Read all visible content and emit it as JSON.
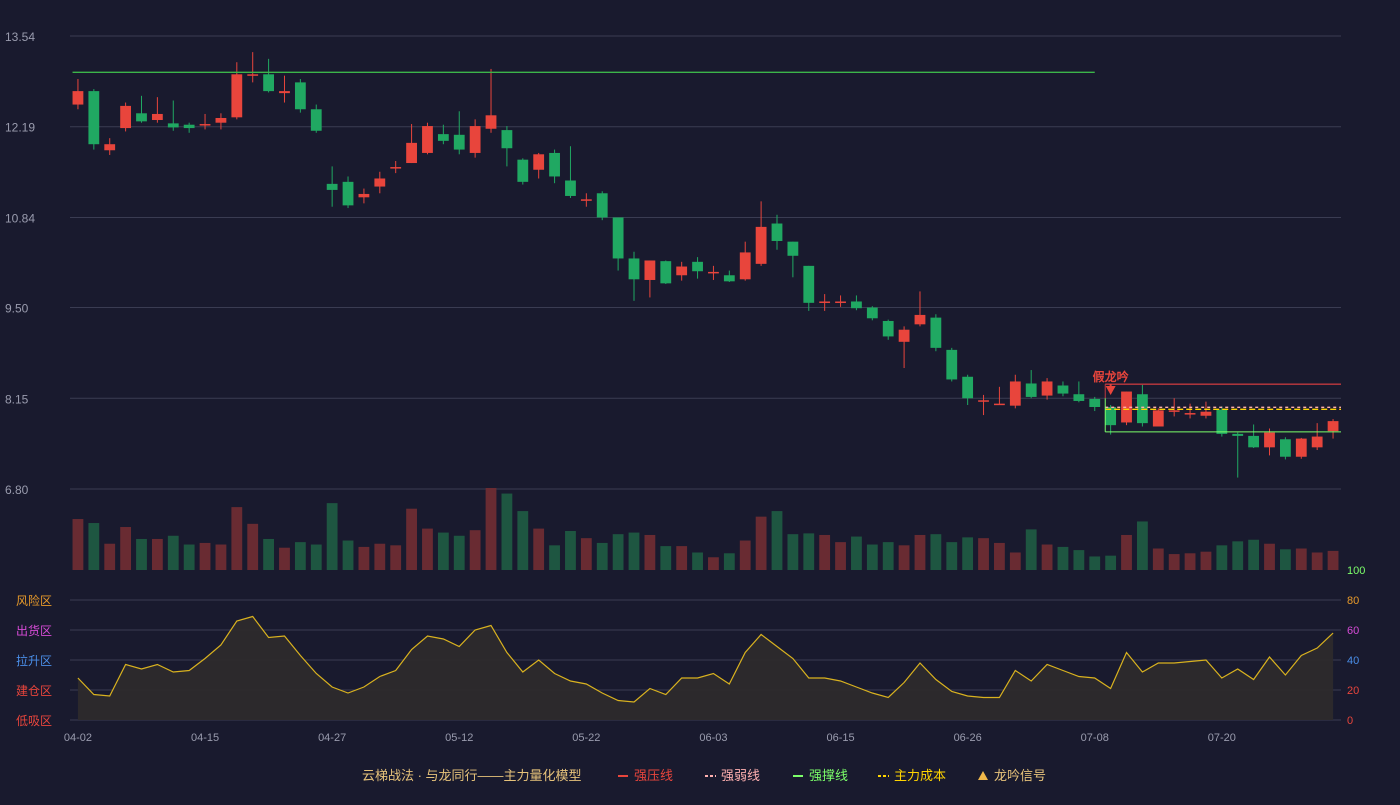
{
  "colors": {
    "background": "#191a2e",
    "up": "#e8453c",
    "down": "#20a862",
    "grid": "#3a3c52",
    "axis_text": "#9a9cae",
    "resistance": "#e8453c",
    "weak": "#ffb0b0",
    "support": "#7cff6a",
    "cost": "#ffd400",
    "signal": "#f0b84a",
    "osc_line": "#d9b21f",
    "zone_risk": "#e89a2a",
    "zone_sell": "#d64bd6",
    "zone_rise": "#4a8ee8",
    "zone_build": "#e8453c",
    "zone_low": "#e8453c"
  },
  "chart_data": [
    {
      "type": "candlestick",
      "ylim": [
        6.8,
        13.54
      ],
      "y_ticks": [
        "13.54",
        "12.19",
        "10.84",
        "9.50",
        "8.15",
        "6.80"
      ],
      "x_tick_labels": [
        {
          "index": 0,
          "label": "04-02"
        },
        {
          "index": 8,
          "label": "04-15"
        },
        {
          "index": 16,
          "label": "04-27"
        },
        {
          "index": 24,
          "label": "05-12"
        },
        {
          "index": 32,
          "label": "05-22"
        },
        {
          "index": 40,
          "label": "06-03"
        },
        {
          "index": 48,
          "label": "06-15"
        },
        {
          "index": 56,
          "label": "06-26"
        },
        {
          "index": 64,
          "label": "07-08"
        },
        {
          "index": 72,
          "label": "07-20"
        }
      ],
      "candles": [
        [
          12.52,
          12.72,
          12.9,
          12.45
        ],
        [
          12.72,
          11.93,
          12.75,
          11.85
        ],
        [
          11.84,
          11.93,
          12.02,
          11.77
        ],
        [
          12.17,
          12.5,
          12.55,
          12.12
        ],
        [
          12.39,
          12.27,
          12.65,
          12.25
        ],
        [
          12.29,
          12.38,
          12.63,
          12.25
        ],
        [
          12.24,
          12.18,
          12.58,
          12.13
        ],
        [
          12.22,
          12.17,
          12.25,
          12.1
        ],
        [
          12.23,
          12.23,
          12.38,
          12.15
        ],
        [
          12.25,
          12.32,
          12.39,
          12.15
        ],
        [
          12.33,
          12.97,
          13.15,
          12.3
        ],
        [
          12.95,
          12.97,
          13.3,
          12.85
        ],
        [
          12.97,
          12.72,
          13.2,
          12.7
        ],
        [
          12.69,
          12.72,
          12.95,
          12.55
        ],
        [
          12.85,
          12.45,
          12.9,
          12.4
        ],
        [
          12.45,
          12.13,
          12.52,
          12.1
        ],
        [
          11.34,
          11.25,
          11.6,
          11.0
        ],
        [
          11.37,
          11.02,
          11.45,
          10.98
        ],
        [
          11.14,
          11.19,
          11.27,
          11.05
        ],
        [
          11.3,
          11.42,
          11.52,
          11.2
        ],
        [
          11.59,
          11.59,
          11.68,
          11.5
        ],
        [
          11.65,
          11.95,
          12.23,
          11.65
        ],
        [
          11.8,
          12.2,
          12.25,
          11.78
        ],
        [
          12.08,
          11.98,
          12.22,
          11.93
        ],
        [
          12.07,
          11.85,
          12.42,
          11.78
        ],
        [
          11.8,
          12.2,
          12.3,
          11.73
        ],
        [
          12.16,
          12.36,
          13.05,
          12.1
        ],
        [
          12.14,
          11.87,
          12.2,
          11.6
        ],
        [
          11.7,
          11.37,
          11.72,
          11.33
        ],
        [
          11.55,
          11.78,
          11.8,
          11.42
        ],
        [
          11.8,
          11.45,
          11.85,
          11.35
        ],
        [
          11.39,
          11.16,
          11.9,
          11.13
        ],
        [
          11.11,
          11.11,
          11.2,
          11.0
        ],
        [
          11.2,
          10.84,
          11.23,
          10.8
        ],
        [
          10.84,
          10.23,
          10.84,
          10.05
        ],
        [
          10.23,
          9.92,
          10.33,
          9.6
        ],
        [
          9.91,
          10.2,
          10.2,
          9.65
        ],
        [
          10.19,
          9.86,
          10.2,
          9.85
        ],
        [
          9.98,
          10.11,
          10.18,
          9.9
        ],
        [
          10.18,
          10.04,
          10.25,
          9.93
        ],
        [
          10.03,
          10.03,
          10.12,
          9.91
        ],
        [
          9.98,
          9.89,
          10.05,
          9.88
        ],
        [
          9.92,
          10.32,
          10.48,
          9.9
        ],
        [
          10.15,
          10.7,
          11.08,
          10.12
        ],
        [
          10.75,
          10.49,
          10.88,
          10.36
        ],
        [
          10.48,
          10.27,
          10.48,
          9.95
        ],
        [
          10.12,
          9.57,
          10.12,
          9.45
        ],
        [
          9.59,
          9.59,
          9.7,
          9.45
        ],
        [
          9.59,
          9.59,
          9.68,
          9.51
        ],
        [
          9.59,
          9.49,
          9.68,
          9.46
        ],
        [
          9.5,
          9.34,
          9.52,
          9.31
        ],
        [
          9.3,
          9.07,
          9.32,
          9.02
        ],
        [
          8.99,
          9.17,
          9.22,
          8.6
        ],
        [
          9.25,
          9.39,
          9.74,
          9.22
        ],
        [
          9.35,
          8.9,
          9.4,
          8.85
        ],
        [
          8.87,
          8.43,
          8.9,
          8.4
        ],
        [
          8.47,
          8.15,
          8.5,
          8.05
        ],
        [
          8.12,
          8.12,
          8.2,
          7.9
        ],
        [
          8.07,
          8.07,
          8.32,
          8.05
        ],
        [
          8.04,
          8.4,
          8.5,
          8.0
        ],
        [
          8.37,
          8.17,
          8.57,
          8.15
        ],
        [
          8.19,
          8.4,
          8.45,
          8.13
        ],
        [
          8.34,
          8.22,
          8.4,
          8.18
        ],
        [
          8.21,
          8.11,
          8.4,
          8.09
        ],
        [
          8.14,
          8.02,
          8.17,
          7.96
        ],
        [
          8.02,
          7.75,
          8.05,
          7.61
        ],
        [
          7.79,
          8.25,
          8.25,
          7.75
        ],
        [
          8.21,
          7.78,
          8.35,
          7.73
        ],
        [
          7.73,
          7.97,
          8.0,
          7.73
        ],
        [
          7.97,
          7.97,
          8.15,
          7.88
        ],
        [
          7.93,
          7.93,
          8.07,
          7.85
        ],
        [
          7.89,
          7.95,
          8.1,
          7.85
        ],
        [
          7.98,
          7.62,
          8.03,
          7.58
        ],
        [
          7.62,
          7.59,
          7.64,
          6.97
        ],
        [
          7.59,
          7.42,
          7.76,
          7.41
        ],
        [
          7.42,
          7.64,
          7.7,
          7.3
        ],
        [
          7.54,
          7.28,
          7.57,
          7.24
        ],
        [
          7.28,
          7.55,
          7.56,
          7.25
        ],
        [
          7.42,
          7.58,
          7.78,
          7.38
        ],
        [
          7.66,
          7.81,
          7.84,
          7.55
        ]
      ],
      "lines": [
        {
          "name": "强压线",
          "style": "resistance",
          "value": 13.0,
          "from": 0,
          "to": 64
        },
        {
          "name": "强压线",
          "style": "resistance",
          "value": 8.36,
          "from": 65,
          "to": 79
        },
        {
          "name": "强弱线",
          "style": "weak",
          "value": 8.0,
          "from": 65,
          "to": 79
        },
        {
          "name": "主力成本",
          "style": "cost",
          "value": 8.0,
          "from": 65,
          "to": 79
        },
        {
          "name": "强撑线",
          "style": "support",
          "value": 7.65,
          "from": 65,
          "to": 79
        }
      ],
      "signal": {
        "index": 65,
        "label": "假龙吟"
      }
    },
    {
      "type": "bar",
      "values": [
        64,
        59,
        33,
        54,
        39,
        39,
        43,
        32,
        34,
        32,
        79,
        58,
        39,
        28,
        35,
        32,
        84,
        37,
        29,
        33,
        31,
        77,
        52,
        47,
        43,
        50,
        103,
        96,
        74,
        52,
        31,
        49,
        40,
        34,
        45,
        47,
        44,
        30,
        30,
        22,
        16,
        21,
        37,
        67,
        74,
        45,
        46,
        44,
        35,
        42,
        32,
        35,
        31,
        44,
        45,
        35,
        41,
        40,
        34,
        22,
        51,
        32,
        29,
        25,
        17,
        18,
        44,
        61,
        27,
        20,
        21,
        23,
        31,
        36,
        38,
        33,
        26,
        27,
        22,
        24,
        21,
        21
      ],
      "ymax": 103
    },
    {
      "type": "area",
      "ylim": [
        0,
        100
      ],
      "y_ticks": [
        "100",
        "80",
        "60",
        "40",
        "20",
        "0"
      ],
      "zones": [
        "风险区",
        "出货区",
        "拉升区",
        "建仓区",
        "低吸区"
      ],
      "values": [
        28,
        17,
        16,
        37,
        34,
        37,
        32,
        33,
        41,
        50,
        66,
        69,
        55,
        56,
        43,
        31,
        22,
        18,
        22,
        29,
        33,
        47,
        56,
        54,
        49,
        60,
        63,
        45,
        32,
        40,
        31,
        26,
        24,
        18,
        13,
        12,
        21,
        17,
        28,
        28,
        31,
        24,
        45,
        57,
        49,
        41,
        28,
        28,
        26,
        22,
        18,
        15,
        25,
        38,
        27,
        19,
        16,
        15,
        15,
        33,
        26,
        37,
        33,
        29,
        28,
        21,
        45,
        32,
        38,
        38,
        39,
        40,
        28,
        34,
        27,
        42,
        30,
        43,
        48,
        58
      ]
    }
  ],
  "legend": {
    "title": "云梯战法 · 与龙同行——主力量化模型",
    "items": [
      {
        "label": "强压线",
        "style": "resistance",
        "glyph": "line"
      },
      {
        "label": "强弱线",
        "style": "weak",
        "glyph": "dash"
      },
      {
        "label": "强撑线",
        "style": "support",
        "glyph": "line"
      },
      {
        "label": "主力成本",
        "style": "cost",
        "glyph": "dash"
      },
      {
        "label": "龙吟信号",
        "style": "signal",
        "glyph": "triangle"
      }
    ]
  }
}
